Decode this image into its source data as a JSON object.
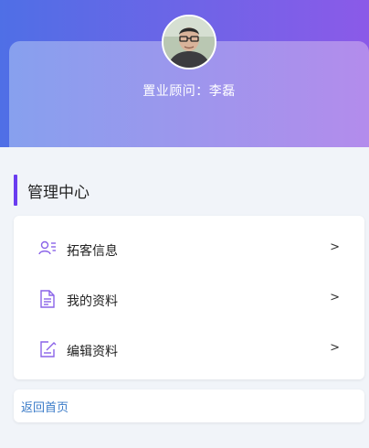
{
  "header": {
    "advisor_label": "置业顾问：李磊",
    "gradient_start": "#4f6fe6",
    "gradient_end": "#8b5ae8"
  },
  "section": {
    "title": "管理中心",
    "accent_color": "#6a3cf0"
  },
  "menu": {
    "items": [
      {
        "label": "拓客信息",
        "icon": "user-list-icon",
        "arrow": ">"
      },
      {
        "label": "我的资料",
        "icon": "document-icon",
        "arrow": ">"
      },
      {
        "label": "编辑资料",
        "icon": "edit-icon",
        "arrow": ">"
      }
    ]
  },
  "footer": {
    "back_label": "返回首页",
    "link_color": "#3a7bc8"
  }
}
